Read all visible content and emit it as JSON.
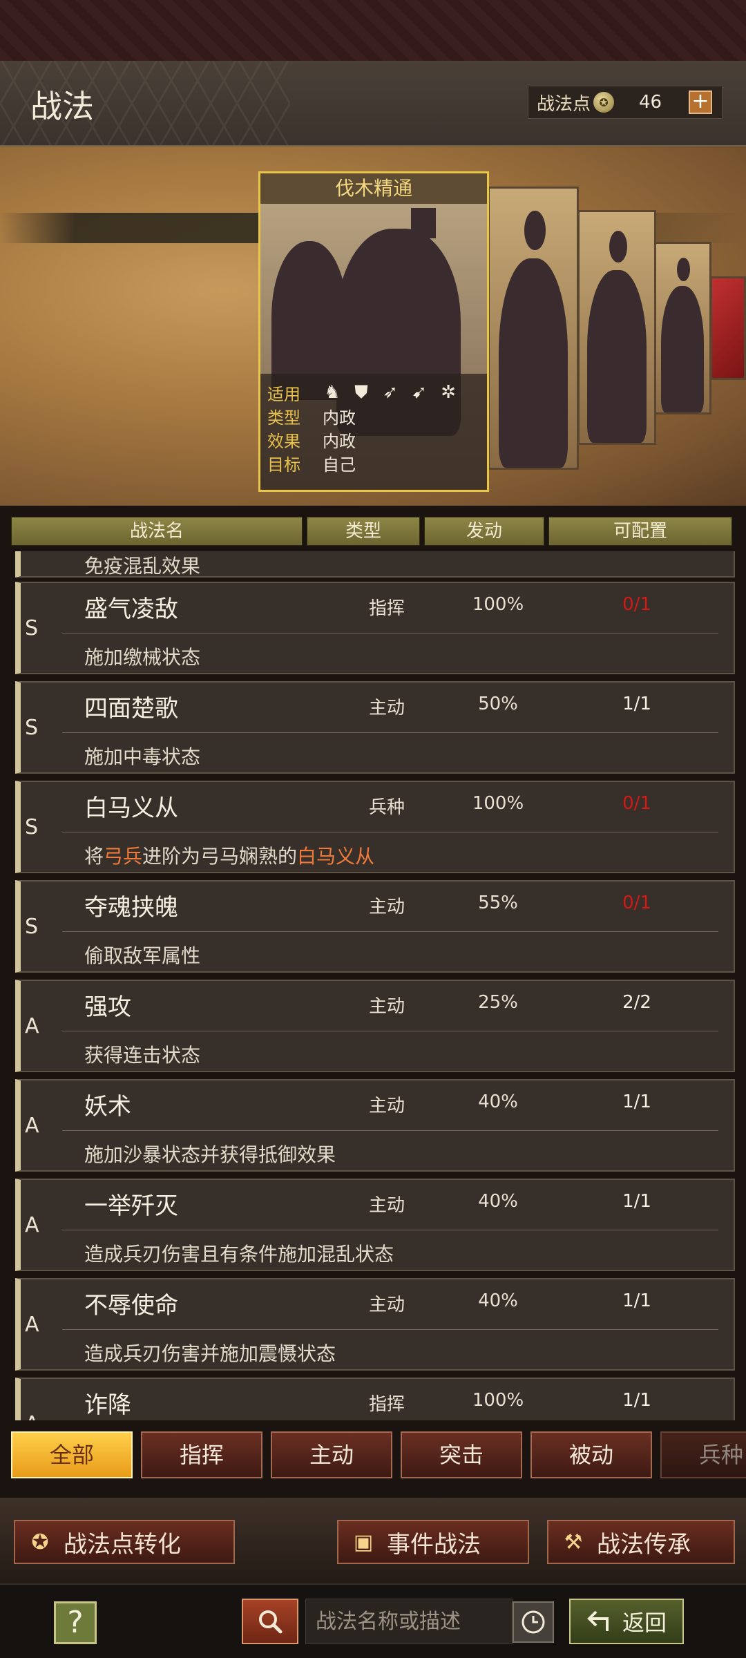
{
  "header": {
    "title": "战法",
    "points_label": "战法点",
    "points_value": "46",
    "add_label": "+"
  },
  "card": {
    "title": "伐木精通",
    "info": [
      {
        "key": "适用",
        "value": ""
      },
      {
        "key": "类型",
        "value": "内政"
      },
      {
        "key": "效果",
        "value": "内政"
      },
      {
        "key": "目标",
        "value": "自己"
      }
    ],
    "troop_icons": [
      "cavalry-icon",
      "shield-icon",
      "bow-icon",
      "spear-icon",
      "wheel-icon"
    ]
  },
  "table": {
    "columns": [
      "战法名",
      "类型",
      "发动",
      "可配置"
    ],
    "partial_top_desc": "免疫混乱效果",
    "rows": [
      {
        "grade": "S",
        "name": "盛气凌敌",
        "type": "指挥",
        "rate": "100%",
        "slots": "0/1",
        "slots_full": true,
        "desc": "施加缴械状态"
      },
      {
        "grade": "S",
        "name": "四面楚歌",
        "type": "主动",
        "rate": "50%",
        "slots": "1/1",
        "slots_full": false,
        "desc": "施加中毒状态"
      },
      {
        "grade": "S",
        "name": "白马义从",
        "type": "兵种",
        "rate": "100%",
        "slots": "0/1",
        "slots_full": true,
        "desc_parts": [
          "将",
          "弓兵",
          "进阶为弓马娴熟的",
          "白马义从"
        ]
      },
      {
        "grade": "S",
        "name": "夺魂挟魄",
        "type": "主动",
        "rate": "55%",
        "slots": "0/1",
        "slots_full": true,
        "desc": "偷取敌军属性"
      },
      {
        "grade": "A",
        "name": "强攻",
        "type": "主动",
        "rate": "25%",
        "slots": "2/2",
        "slots_full": false,
        "desc": "获得连击状态"
      },
      {
        "grade": "A",
        "name": "妖术",
        "type": "主动",
        "rate": "40%",
        "slots": "1/1",
        "slots_full": false,
        "desc": "施加沙暴状态并获得抵御效果"
      },
      {
        "grade": "A",
        "name": "一举歼灭",
        "type": "主动",
        "rate": "40%",
        "slots": "1/1",
        "slots_full": false,
        "desc": "造成兵刃伤害且有条件施加混乱状态"
      },
      {
        "grade": "A",
        "name": "不辱使命",
        "type": "主动",
        "rate": "40%",
        "slots": "1/1",
        "slots_full": false,
        "desc": "造成兵刃伤害并施加震慑状态"
      },
      {
        "grade": "A",
        "name": "诈降",
        "type": "指挥",
        "rate": "100%",
        "slots": "1/1",
        "slots_full": false,
        "desc": ""
      }
    ]
  },
  "filters": [
    "全部",
    "指挥",
    "主动",
    "突击",
    "被动",
    "兵种"
  ],
  "actions": {
    "convert": "战法点转化",
    "event": "事件战法",
    "inherit": "战法传承"
  },
  "bottom": {
    "help": "?",
    "search_placeholder": "战法名称或描述",
    "back": "返回"
  },
  "colors": {
    "accent_gold": "#e9c64a",
    "full_slots": "#d41818",
    "highlight": "#ef7a3a"
  }
}
